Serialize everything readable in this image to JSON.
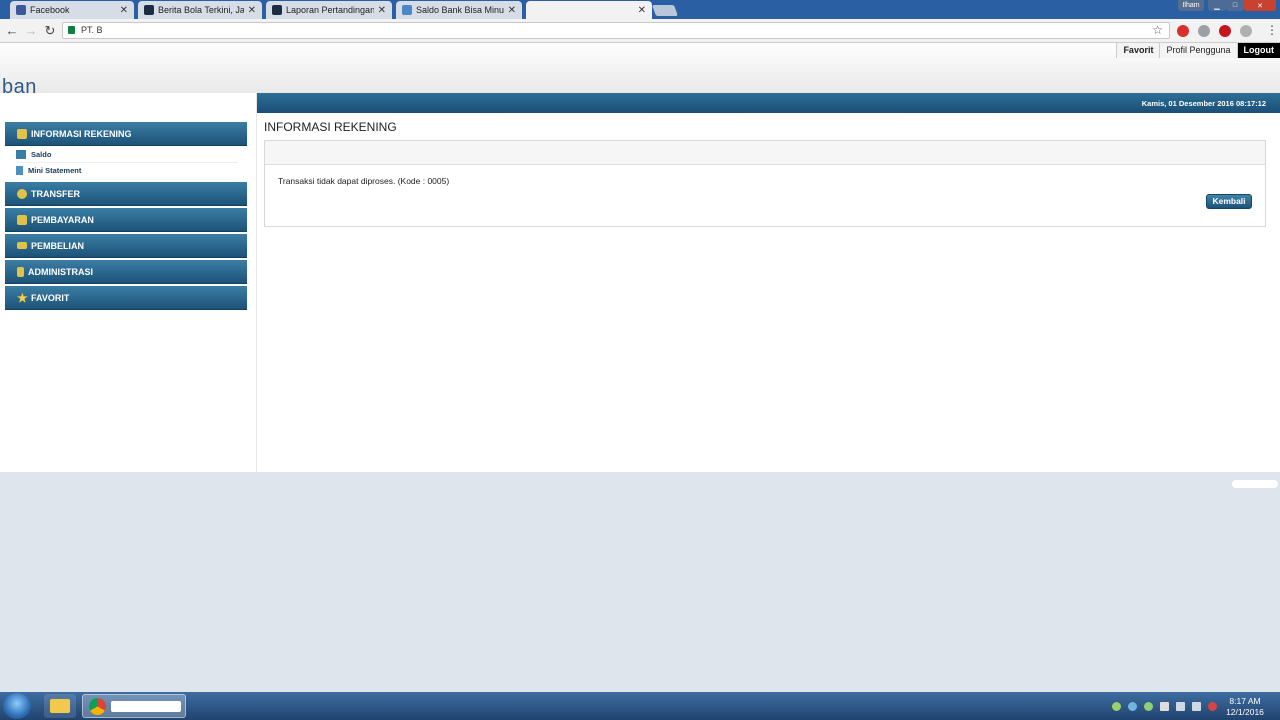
{
  "browser": {
    "tabs": [
      {
        "title": "Facebook",
        "active": false
      },
      {
        "title": "Berita Bola Terkini, Jadwal",
        "active": false
      },
      {
        "title": "Laporan Pertandingan M",
        "active": false
      },
      {
        "title": "Saldo Bank Bisa Minus a",
        "active": false
      },
      {
        "title": "",
        "active": true
      }
    ],
    "user_badge": "Ilham",
    "address": "PT. B"
  },
  "header": {
    "logo_text": "ban",
    "top_links": {
      "favorit": "Favorit",
      "profil": "Profil Pengguna",
      "logout": "Logout"
    }
  },
  "banner": {
    "date": "Kamis, 01 Desember 2016 08:17:12"
  },
  "sidebar": {
    "informasi_rekening": "INFORMASI REKENING",
    "saldo": "Saldo",
    "mini_statement": "Mini Statement",
    "transfer": "TRANSFER",
    "pembayaran": "PEMBAYARAN",
    "pembelian": "PEMBELIAN",
    "administrasi": "ADMINISTRASI",
    "favorit": "FAVORIT"
  },
  "content": {
    "title": "INFORMASI REKENING",
    "message": "Transaksi tidak dapat diproses. (Kode : 0005)",
    "button": "Kembali"
  },
  "taskbar": {
    "time": "8:17 AM",
    "date": "12/1/2016"
  },
  "colors": {
    "menu_blue": "#1d5277",
    "tab_strip": "#2a5fa3"
  }
}
